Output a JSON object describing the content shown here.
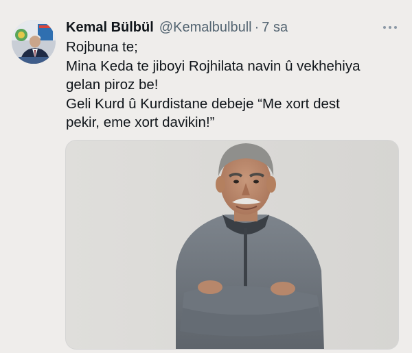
{
  "tweet": {
    "author": {
      "display_name": "Kemal Bülbül",
      "handle": "@Kemalbulbull",
      "separator": "·",
      "time": "7 sa"
    },
    "avatar": {
      "icon": "profile-photo"
    },
    "more_icon": "more-horizontal-icon",
    "text_lines": [
      "Rojbuna te;",
      "Mina Keda te jiboyi Rojhilata navin û vekhehiya",
      "gelan piroz be!",
      "Geli Kurd û Kurdistane debeje “Me xort dest",
      "pekir, eme xort davikin!”"
    ],
    "media": {
      "icon": "attached-photo"
    }
  },
  "colors": {
    "background": "#efedeb",
    "text": "#0f1419",
    "secondary_text": "#536471"
  }
}
